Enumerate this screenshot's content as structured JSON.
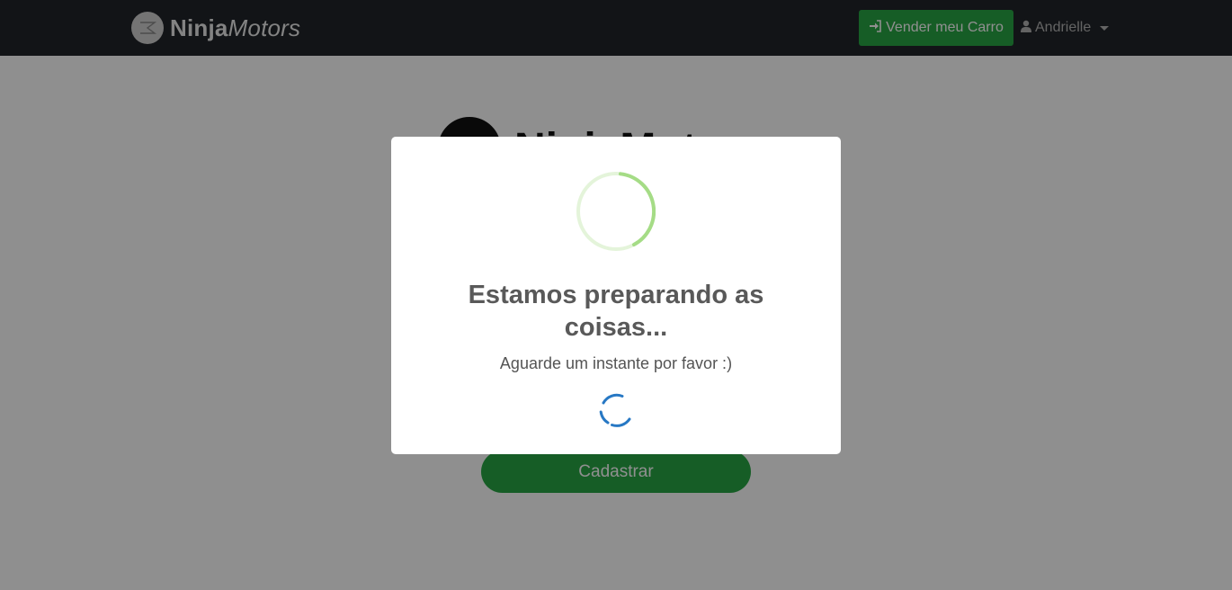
{
  "navbar": {
    "brand": {
      "name_bold": "Ninja",
      "name_italic": "Motors",
      "logo_icon": "car-logo-icon"
    },
    "sell_button": {
      "icon": "sign-in-icon",
      "label": "Vender meu Carro"
    },
    "user_menu": {
      "icon": "user-icon",
      "label": "Andrielle"
    }
  },
  "page": {
    "register_button": "Cadastrar"
  },
  "modal": {
    "title": "Estamos preparando as coisas...",
    "message": "Aguarde um instante por favor :)",
    "icon": "loading-ring-icon",
    "loader": "spinner-icon"
  },
  "colors": {
    "navbar_bg": "#212529",
    "accent_green": "#28a745",
    "ring_green": "#a5dc86",
    "spinner_blue": "#2778c4"
  }
}
